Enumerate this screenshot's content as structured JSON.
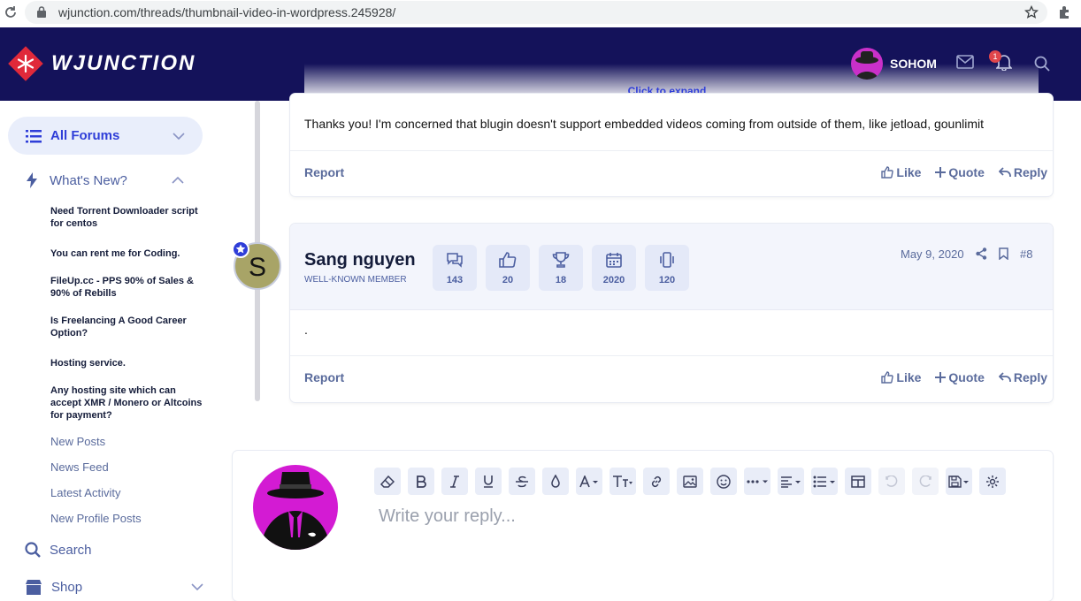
{
  "browser": {
    "url": "wjunction.com/threads/thumbnail-video-in-wordpress.245928/"
  },
  "header": {
    "logo_text": "WJUNCTION",
    "expand_label": "Click to expand...",
    "username": "SOHOM",
    "notification_count": "1",
    "colors": {
      "background": "#14125a",
      "accent": "#2f3ed8"
    }
  },
  "sidebar": {
    "all_forums": "All Forums",
    "whats_new": "What's New?",
    "threads": [
      "Need Torrent Downloader script for centos",
      "You can rent me for Coding.",
      "FileUp.cc - PPS 90% of Sales & 90% of Rebills",
      "Is Freelancing A Good Career Option?",
      "Hosting service.",
      "Any hosting site which can accept XMR / Monero or Altcoins for payment?"
    ],
    "links": [
      "New Posts",
      "News Feed",
      "Latest Activity",
      "New Profile Posts"
    ],
    "search": "Search",
    "shop": "Shop"
  },
  "post1": {
    "body": "Thanks you! I'm concerned that blugin doesn't support embedded videos coming from outside of them, like jetload, gounlimit",
    "report": "Report",
    "like": "Like",
    "quote": "Quote",
    "reply": "Reply"
  },
  "post2": {
    "avatar_letter": "S",
    "author": "Sang nguyen",
    "role": "WELL-KNOWN MEMBER",
    "stats": [
      {
        "icon": "messages-icon",
        "value": "143"
      },
      {
        "icon": "thumbs-up-icon",
        "value": "20"
      },
      {
        "icon": "trophy-icon",
        "value": "18"
      },
      {
        "icon": "calendar-icon",
        "value": "2020"
      },
      {
        "icon": "phone-icon",
        "value": "120"
      }
    ],
    "date": "May 9, 2020",
    "number": "#8",
    "body": ".",
    "report": "Report",
    "like": "Like",
    "quote": "Quote",
    "reply": "Reply"
  },
  "reply": {
    "placeholder": "Write your reply..."
  }
}
